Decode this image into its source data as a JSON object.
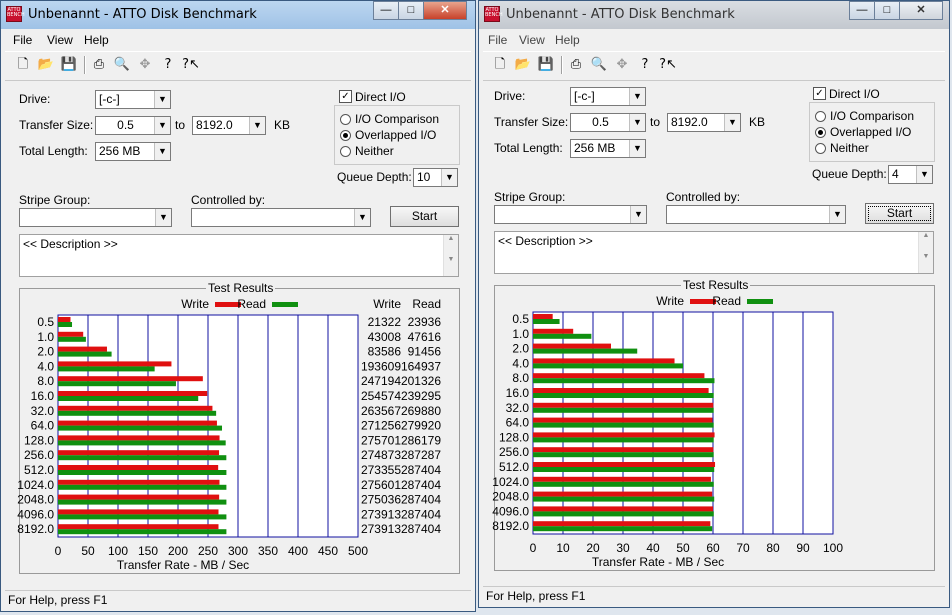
{
  "windows": [
    {
      "title": "Unbenannt - ATTO Disk Benchmark",
      "app_icon_text": "ATTO BENCH",
      "window_controls": {
        "minimize": "—",
        "maximize": "□",
        "close": "✕"
      },
      "menu": [
        "File",
        "View",
        "Help"
      ],
      "toolbar_icons": [
        "new-icon",
        "open-icon",
        "save-icon",
        "print-icon",
        "print-preview-icon",
        "move-icon",
        "help-icon",
        "context-help-icon"
      ],
      "drive_label": "Drive:",
      "drive_value": "[-c-]",
      "transfer_size_label": "Transfer Size:",
      "transfer_from": "0.5",
      "to_label": "to",
      "transfer_to": "8192.0",
      "kb_label": "KB",
      "total_length_label": "Total Length:",
      "total_length_value": "256 MB",
      "direct_io_label": "Direct I/O",
      "direct_io_checked": true,
      "io_options": [
        "I/O Comparison",
        "Overlapped I/O",
        "Neither"
      ],
      "io_selected": "Overlapped I/O",
      "queue_depth_label": "Queue Depth:",
      "queue_depth_value": "10",
      "stripe_group_label": "Stripe Group:",
      "controlled_by_label": "Controlled by:",
      "start_label": "Start",
      "description": "<< Description >>",
      "results_title": "Test Results",
      "legend_write": "Write",
      "legend_read": "Read",
      "col_write": "Write",
      "col_read": "Read",
      "xlabel": "Transfer Rate - MB / Sec",
      "status": "For Help, press F1",
      "chart_data": {
        "type": "bar",
        "orientation": "horizontal",
        "categories": [
          "0.5",
          "1.0",
          "2.0",
          "4.0",
          "8.0",
          "16.0",
          "32.0",
          "64.0",
          "128.0",
          "256.0",
          "512.0",
          "1024.0",
          "2048.0",
          "4096.0",
          "8192.0"
        ],
        "series": [
          {
            "name": "Write",
            "color": "#e01010",
            "values": [
              21322,
              43008,
              83586,
              193609,
              247194,
              254574,
              263567,
              271256,
              275701,
              274873,
              273355,
              275601,
              275036,
              273913,
              273913
            ]
          },
          {
            "name": "Read",
            "color": "#109010",
            "values": [
              23936,
              47616,
              91456,
              164937,
              201326,
              239295,
              269880,
              279920,
              286179,
              287287,
              287404,
              287404,
              287404,
              287404,
              287404
            ]
          }
        ],
        "xlim": [
          0,
          500
        ],
        "xticks": [
          "0",
          "50",
          "100",
          "150",
          "200",
          "250",
          "300",
          "350",
          "400",
          "450",
          "500"
        ],
        "value_unit": "KB/s",
        "grid": true,
        "legend": "top"
      }
    },
    {
      "title": "Unbenannt - ATTO Disk Benchmark",
      "app_icon_text": "ATTO BENCH",
      "window_controls": {
        "minimize": "—",
        "maximize": "□",
        "close": "✕"
      },
      "menu": [
        "File",
        "View",
        "Help"
      ],
      "toolbar_icons": [
        "new-icon",
        "open-icon",
        "save-icon",
        "print-icon",
        "print-preview-icon",
        "move-icon",
        "help-icon",
        "context-help-icon"
      ],
      "drive_label": "Drive:",
      "drive_value": "[-c-]",
      "transfer_size_label": "Transfer Size:",
      "transfer_from": "0.5",
      "to_label": "to",
      "transfer_to": "8192.0",
      "kb_label": "KB",
      "total_length_label": "Total Length:",
      "total_length_value": "256 MB",
      "direct_io_label": "Direct I/O",
      "direct_io_checked": true,
      "io_options": [
        "I/O Comparison",
        "Overlapped I/O",
        "Neither"
      ],
      "io_selected": "Overlapped I/O",
      "queue_depth_label": "Queue Depth:",
      "queue_depth_value": "4",
      "stripe_group_label": "Stripe Group:",
      "controlled_by_label": "Controlled by:",
      "start_label": "Start",
      "description": "<< Description >>",
      "results_title": "Test Results",
      "legend_write": "Write",
      "legend_read": "Read",
      "col_write": "Write",
      "col_read": "Read",
      "xlabel": "Transfer Rate - MB / Sec",
      "status": "For Help, press F1",
      "chart_data": {
        "type": "bar",
        "orientation": "horizontal",
        "categories": [
          "0.5",
          "1.0",
          "2.0",
          "4.0",
          "8.0",
          "16.0",
          "32.0",
          "64.0",
          "128.0",
          "256.0",
          "512.0",
          "1024.0",
          "2048.0",
          "4096.0",
          "8192.0"
        ],
        "series": [
          {
            "name": "Write",
            "color": "#e01010",
            "values": [
              6716,
              13721,
              26624,
              48306,
              58514,
              59941,
              61536,
              61248,
              61972,
              61536,
              62137,
              60732,
              61147,
              61426,
              60526
            ]
          },
          {
            "name": "Read",
            "color": "#109010",
            "values": [
              9065,
              19918,
              35573,
              51200,
              61939,
              61680,
              61680,
              61680,
              61680,
              61680,
              61851,
              61709,
              61851,
              61709,
              61147
            ]
          }
        ],
        "xlim": [
          0,
          100
        ],
        "xticks": [
          "0",
          "10",
          "20",
          "30",
          "40",
          "50",
          "60",
          "70",
          "80",
          "90",
          "100"
        ],
        "value_unit": "KB/s",
        "grid": true,
        "legend": "top"
      }
    }
  ],
  "colors": {
    "write": "#e01010",
    "read": "#109010",
    "grid": "#1010a0"
  }
}
